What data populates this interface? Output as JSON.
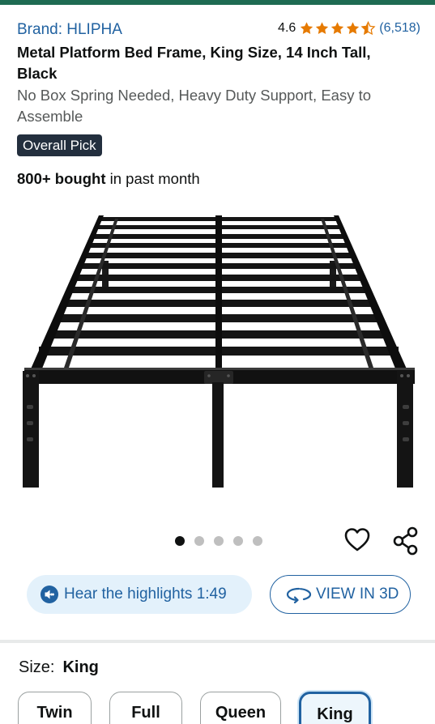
{
  "product": {
    "brand": "Brand: HLIPHA",
    "rating_value": "4.6",
    "rating_stars": 4.6,
    "rating_count": "(6,518)",
    "title": "Metal Platform Bed Frame, King Size, 14 Inch Tall, Black",
    "subtitle": "No Box Spring Needed, Heavy Duty Support, Easy to Assemble",
    "badge": "Overall Pick",
    "bought_bold": "800+ bought",
    "bought_rest": " in past month"
  },
  "gallery": {
    "image_count": 5,
    "active_index": 0
  },
  "actions": {
    "hear_label": "Hear the highlights 1:49",
    "view3d_label": "VIEW IN 3D"
  },
  "size": {
    "label": "Size:",
    "selected": "King",
    "options": [
      "Twin",
      "Full",
      "Queen",
      "King"
    ]
  },
  "colors": {
    "link": "#2162a1",
    "star": "#e67a00",
    "badge_bg": "#232f3e",
    "top_bar": "#1e6b52"
  }
}
